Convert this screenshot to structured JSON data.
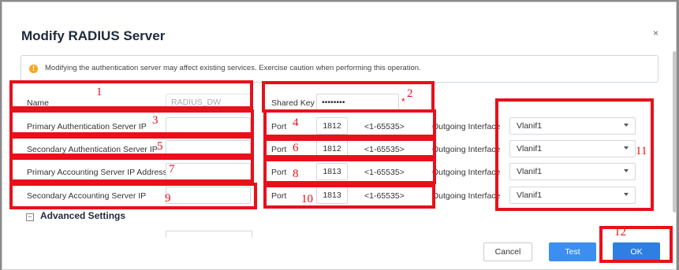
{
  "dialog": {
    "title": "Modify RADIUS Server",
    "close_glyph": "×",
    "warning": "Modifying the authentication server may affect existing services. Exercise caution when performing this operation.",
    "warning_icon": "warning-circle-icon"
  },
  "fields": {
    "name_label": "Name",
    "name_value": "RADIUS_DW",
    "shared_key_label": "Shared Key",
    "shared_key_value": "••••••••",
    "required_mark": "*",
    "rows": [
      {
        "label": "Primary Authentication Server IP",
        "port_label": "Port",
        "port": "1812",
        "range": "<1-65535>",
        "out_label": "Outgoing Interface",
        "interface": "Vlanif1"
      },
      {
        "label": "Secondary Authentication Server IP",
        "port_label": "Port",
        "port": "1812",
        "range": "<1-65535>",
        "out_label": "Outgoing Interface",
        "interface": "Vlanif1"
      },
      {
        "label": "Primary Accounting Server IP Address",
        "port_label": "Port",
        "port": "1813",
        "range": "<1-65535>",
        "out_label": "Outgoing Interface",
        "interface": "Vlanif1"
      },
      {
        "label": "Secondary Accounting Server IP",
        "port_label": "Port",
        "port": "1813",
        "range": "<1-65535>",
        "out_label": "Outgoing Interface",
        "interface": "Vlanif1"
      }
    ]
  },
  "advanced": {
    "toggle_glyph": "−",
    "label": "Advanced Settings"
  },
  "buttons": {
    "cancel": "Cancel",
    "test": "Test",
    "ok": "OK"
  },
  "annotations": [
    "1",
    "2",
    "3",
    "4",
    "5",
    "6",
    "7",
    "8",
    "9",
    "10",
    "11",
    "12"
  ],
  "colors": {
    "annotation": "#e8101a",
    "primary_button": "#2f7fe3"
  }
}
